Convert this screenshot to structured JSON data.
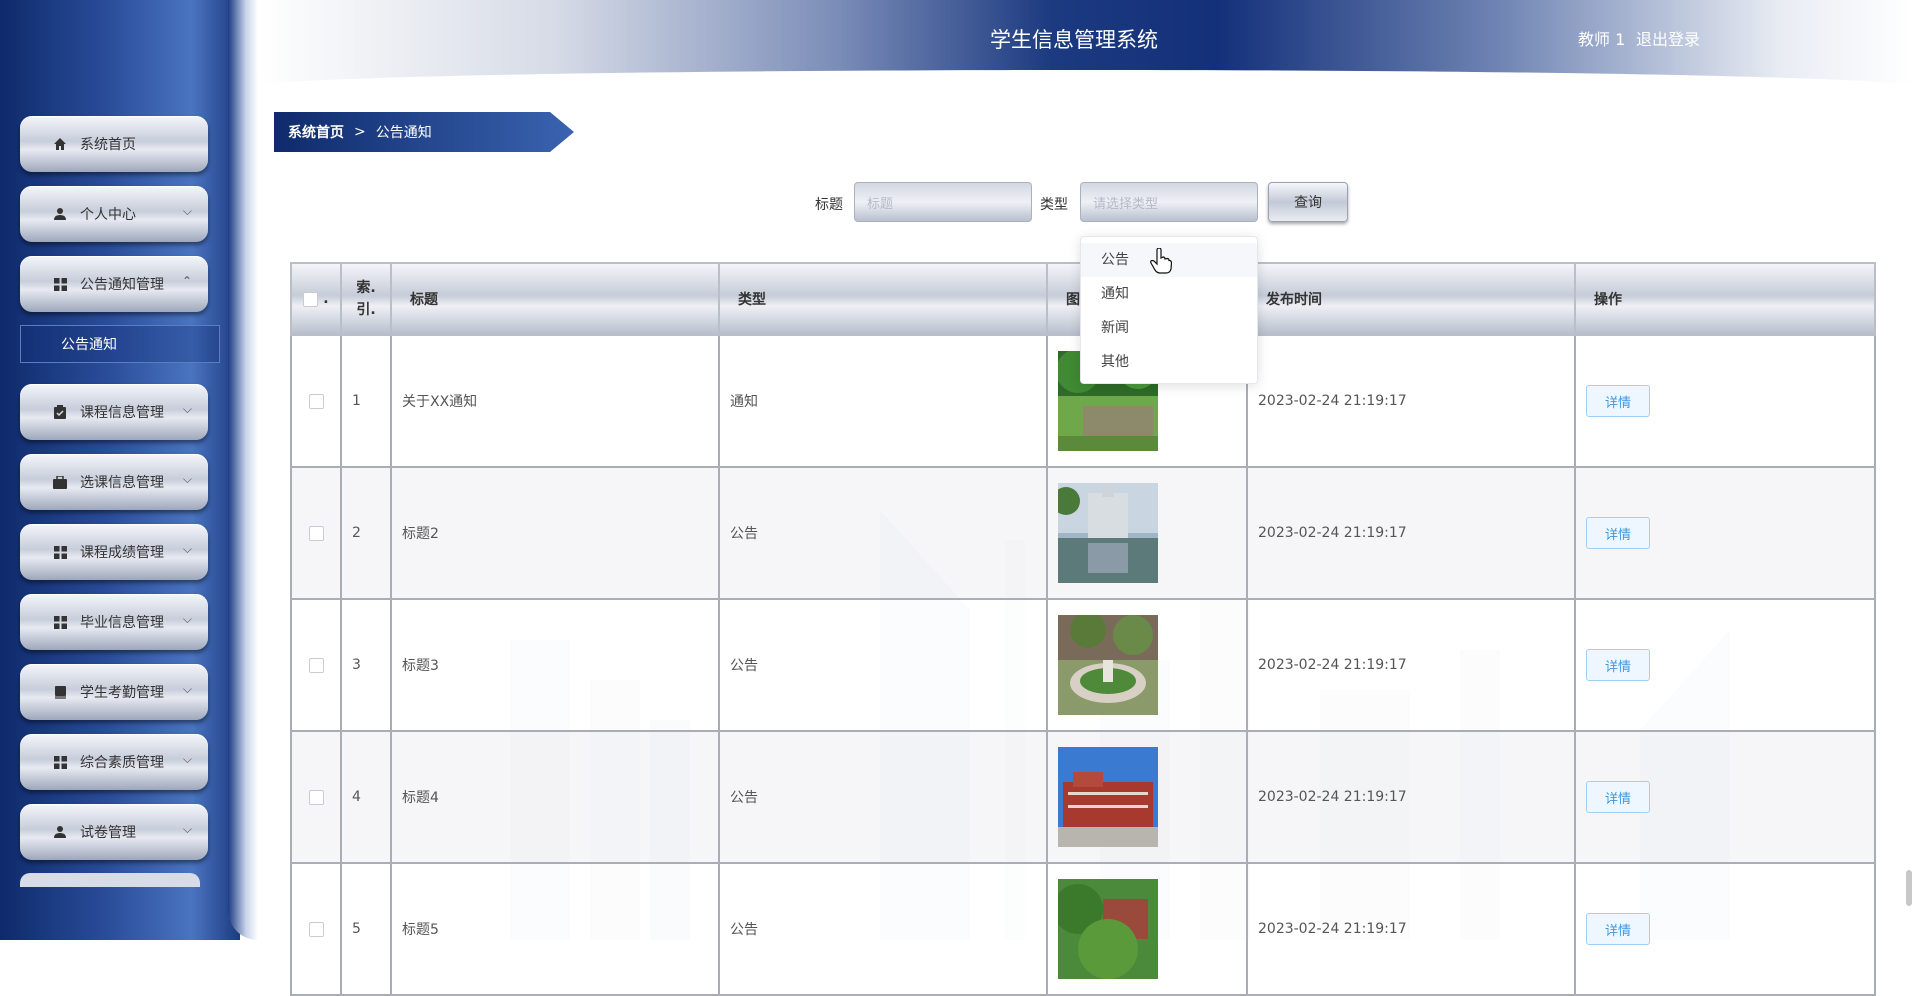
{
  "header": {
    "app_title": "学生信息管理系统",
    "user_name": "教师 1",
    "logout_label": "退出登录"
  },
  "sidebar": {
    "items": [
      {
        "label": "系统首页",
        "icon": "home-icon"
      },
      {
        "label": "个人中心",
        "icon": "user-icon",
        "expandable": true
      },
      {
        "label": "公告通知管理",
        "icon": "grid-icon",
        "expandable": true,
        "expanded": true,
        "children": [
          {
            "label": "公告通知",
            "active": true
          }
        ]
      },
      {
        "label": "课程信息管理",
        "icon": "clipboard-icon",
        "expandable": true
      },
      {
        "label": "选课信息管理",
        "icon": "briefcase-icon",
        "expandable": true
      },
      {
        "label": "课程成绩管理",
        "icon": "grid-icon",
        "expandable": true
      },
      {
        "label": "毕业信息管理",
        "icon": "grid-icon",
        "expandable": true
      },
      {
        "label": "学生考勤管理",
        "icon": "book-icon",
        "expandable": true
      },
      {
        "label": "综合素质管理",
        "icon": "grid-icon",
        "expandable": true
      },
      {
        "label": "试卷管理",
        "icon": "user-icon",
        "expandable": true
      }
    ]
  },
  "breadcrumb": {
    "home": "系统首页",
    "separator": ">",
    "current": "公告通知"
  },
  "search": {
    "title_label": "标题",
    "title_placeholder": "标题",
    "type_label": "类型",
    "type_placeholder": "请选择类型",
    "query_label": "查询",
    "type_options": [
      "公告",
      "通知",
      "新闻",
      "其他"
    ],
    "hovered_option": "公告"
  },
  "table": {
    "columns": {
      "index": "索引",
      "index_line1": "索.",
      "index_line2": "引.",
      "title": "标题",
      "type": "类型",
      "image": "图",
      "publish_time": "发布时间",
      "action": "操作"
    },
    "rows": [
      {
        "index": "1",
        "title": "关于XX通知",
        "type": "通知",
        "image": "park-pond-photo",
        "publish_time": "2023-02-24 21:19:17",
        "action": "详情"
      },
      {
        "index": "2",
        "title": "标题2",
        "type": "公告",
        "image": "building-reflection-photo",
        "publish_time": "2023-02-24 21:19:17",
        "action": "详情"
      },
      {
        "index": "3",
        "title": "标题3",
        "type": "公告",
        "image": "garden-circle-photo",
        "publish_time": "2023-02-24 21:19:17",
        "action": "详情"
      },
      {
        "index": "4",
        "title": "标题4",
        "type": "公告",
        "image": "red-building-photo",
        "publish_time": "2023-02-24 21:19:17",
        "action": "详情"
      },
      {
        "index": "5",
        "title": "标题5",
        "type": "公告",
        "image": "campus-trees-photo",
        "publish_time": "2023-02-24 21:19:17",
        "action": "详情"
      }
    ]
  },
  "colors": {
    "sidebar_dark": "#0e2a6b",
    "sidebar_mid": "#2a4d9a",
    "detail_button_text": "#3b97e6",
    "detail_button_border": "#9fd0f5"
  }
}
